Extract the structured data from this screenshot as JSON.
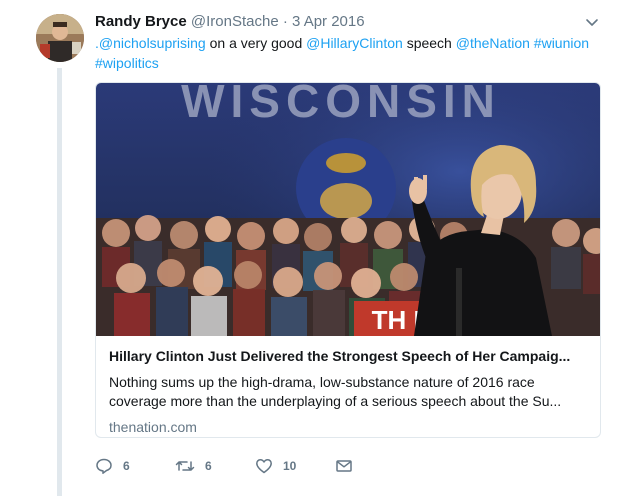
{
  "tweet": {
    "display_name": "Randy Bryce",
    "handle": "@IronStache",
    "separator": "·",
    "date": "3 Apr 2016",
    "text": {
      "part1": ".@nicholsuprising",
      "part2": " on a very good ",
      "part3": "@HillaryClinton",
      "part4": " speech ",
      "part5": "@theNation",
      "part6": " ",
      "part7": "#wiunion",
      "part8": " ",
      "part9": "#wipolitics"
    }
  },
  "card": {
    "photo_sign": "WISCONSIN",
    "photo_banner": "TH  N",
    "title": "Hillary Clinton Just Delivered the Strongest Speech of Her Campaig...",
    "description_line1": "Nothing sums up the high-drama, low-substance nature of 2016 race",
    "description_line2": "coverage more than the underplaying of a serious speech about the Su...",
    "domain": "thenation.com"
  },
  "actions": {
    "replies": "6",
    "retweets": "6",
    "likes": "10"
  },
  "colors": {
    "link": "#1da1f2",
    "secondary_text": "#657786",
    "border": "#e1e8ed"
  },
  "icons": [
    "reply-icon",
    "retweet-icon",
    "like-icon",
    "direct-message-icon",
    "chevron-down-icon"
  ]
}
